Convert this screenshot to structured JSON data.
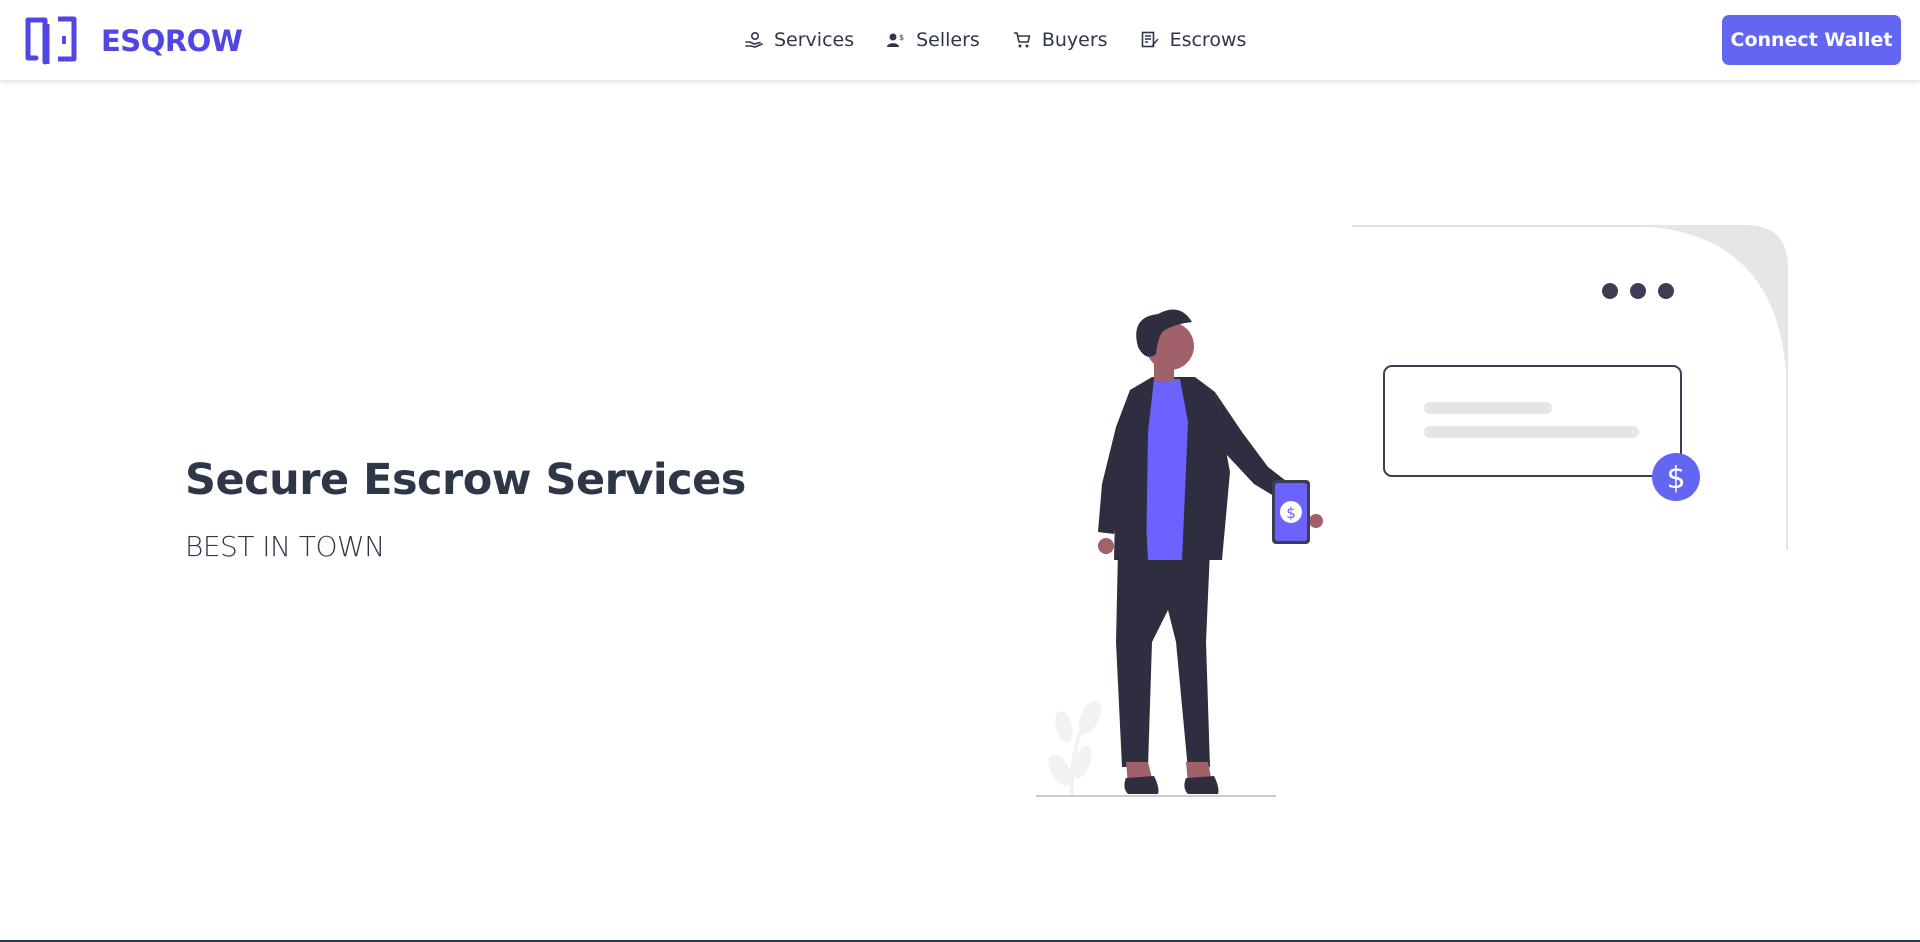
{
  "brand": {
    "name": "ESQROW",
    "logo_icon": "door-logo-icon",
    "color": "#5046e5"
  },
  "nav": {
    "items": [
      {
        "label": "Services",
        "icon": "hand-coin-icon"
      },
      {
        "label": "Sellers",
        "icon": "user-dollar-icon"
      },
      {
        "label": "Buyers",
        "icon": "cart-icon"
      },
      {
        "label": "Escrows",
        "icon": "document-edit-icon"
      }
    ]
  },
  "header": {
    "connect_label": "Connect Wallet",
    "accent": "#6366f1"
  },
  "hero": {
    "title": "Secure Escrow Services",
    "subtitle": "BEST IN TOWN",
    "illustration_currency_symbol": "$"
  }
}
